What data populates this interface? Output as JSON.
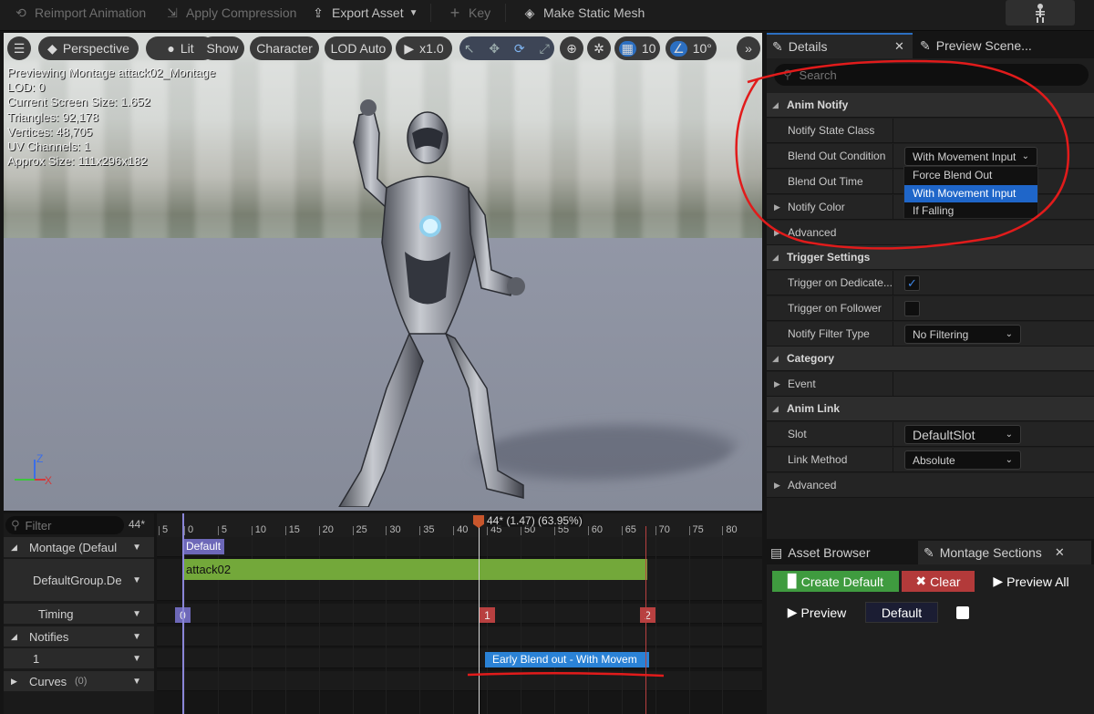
{
  "toolbar": {
    "reimport": "Reimport Animation",
    "apply_compression": "Apply Compression",
    "export_asset": "Export Asset",
    "key": "Key",
    "make_static_mesh": "Make Static Mesh"
  },
  "viewport": {
    "perspective": "Perspective",
    "lit": "Lit",
    "show": "Show",
    "character": "Character",
    "lod": "LOD Auto",
    "speed": "x1.0",
    "grid_snap": "10",
    "angle_snap": "10°",
    "info": [
      "Previewing Montage attack02_Montage",
      "LOD: 0",
      "Current Screen Size: 1.652",
      "Triangles: 92,178",
      "Vertices: 48,705",
      "UV Channels: 1",
      "Approx Size: 111x296x182"
    ],
    "axis_z": "Z",
    "axis_x": "X"
  },
  "details": {
    "tab_details": "Details",
    "tab_preview": "Preview Scene...",
    "search_placeholder": "Search",
    "anim_notify": "Anim Notify",
    "notify_state_class": "Notify State Class",
    "blend_out_condition": "Blend Out Condition",
    "blend_out_condition_value": "With Movement Input",
    "blend_out_time": "Blend Out Time",
    "notify_color": "Notify Color",
    "advanced": "Advanced",
    "dropdown_options": [
      "Force Blend Out",
      "With Movement Input",
      "If Falling"
    ],
    "trigger_settings": "Trigger Settings",
    "trigger_on_dedicated": "Trigger on Dedicate...",
    "trigger_on_follower": "Trigger on Follower",
    "notify_filter_type": "Notify Filter Type",
    "notify_filter_value": "No Filtering",
    "category": "Category",
    "event": "Event",
    "anim_link": "Anim Link",
    "slot": "Slot",
    "slot_value": "DefaultSlot",
    "link_method": "Link Method",
    "link_method_value": "Absolute",
    "advanced2": "Advanced"
  },
  "timeline": {
    "filter_placeholder": "Filter",
    "frame_count": "44*",
    "playhead_label": "44* (1.47) (63.95%)",
    "ticks": [
      "5",
      "0",
      "5",
      "10",
      "15",
      "20",
      "25",
      "30",
      "35",
      "40",
      "45",
      "50",
      "55",
      "60",
      "65",
      "70",
      "75",
      "80"
    ],
    "tracks": {
      "montage": "Montage (Defaul",
      "group": "DefaultGroup.De",
      "timing": "Timing",
      "notifies": "Notifies",
      "notify_track": "1",
      "curves": "Curves",
      "curves_count": "(0)"
    },
    "section_label": "Default",
    "anim_segment": "attack02",
    "timing_markers": [
      "0",
      "1",
      "2"
    ],
    "notify_label": "Early Blend out - With Movem"
  },
  "sections": {
    "tab_asset_browser": "Asset Browser",
    "tab_montage_sections": "Montage Sections",
    "create_default": "Create Default",
    "clear": "Clear",
    "preview_all": "Preview All",
    "preview": "Preview",
    "default": "Default"
  }
}
